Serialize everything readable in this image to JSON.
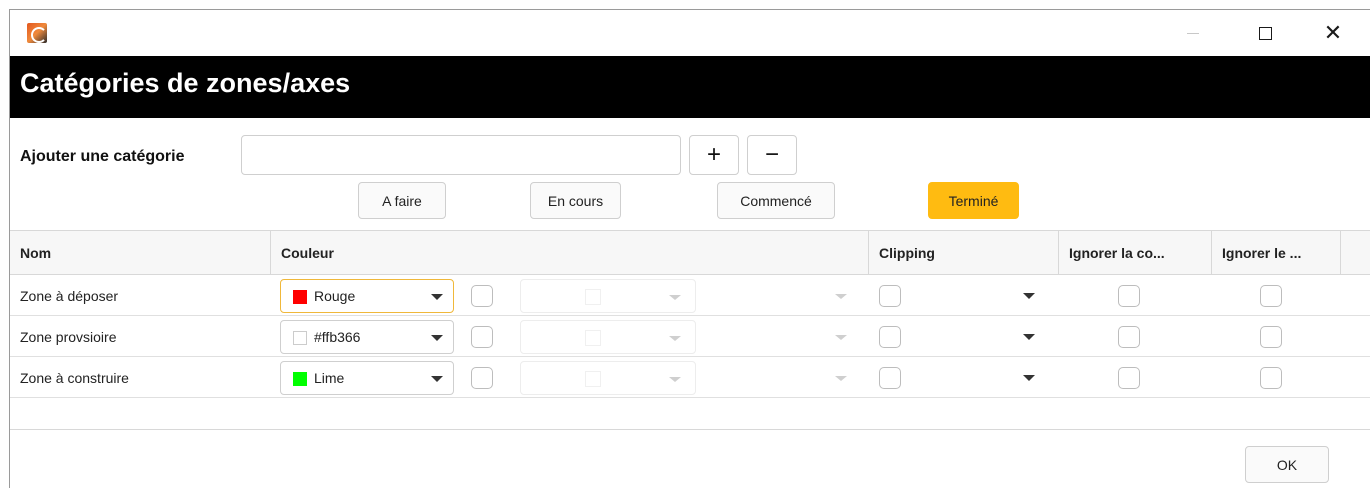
{
  "window": {
    "title": "",
    "controls": {
      "minimize": "minimize-icon",
      "maximize": "maximize-icon",
      "close": "close-icon"
    }
  },
  "header": {
    "title": "Catégories de zones/axes"
  },
  "add_category": {
    "label": "Ajouter une catégorie",
    "input_value": "",
    "add_label": "+",
    "remove_label": "−"
  },
  "status_buttons": [
    {
      "label": "A faire",
      "active": false
    },
    {
      "label": "En cours",
      "active": false
    },
    {
      "label": "Commencé",
      "active": false
    },
    {
      "label": "Terminé",
      "active": true,
      "color": "#ffbb11"
    }
  ],
  "grid": {
    "columns": [
      "Nom",
      "Couleur",
      "Clipping",
      "Ignorer la co...",
      "Ignorer le ..."
    ],
    "rows": [
      {
        "name": "Zone à déposer",
        "color_label": "Rouge",
        "color_hex": "#ff0000",
        "focused": true
      },
      {
        "name": "Zone provsioire",
        "color_label": "#ffb366",
        "color_hex": "#ffffff",
        "focused": false
      },
      {
        "name": "Zone à construire",
        "color_label": "Lime",
        "color_hex": "#00ff00",
        "focused": false
      }
    ]
  },
  "footer": {
    "ok_label": "OK"
  }
}
